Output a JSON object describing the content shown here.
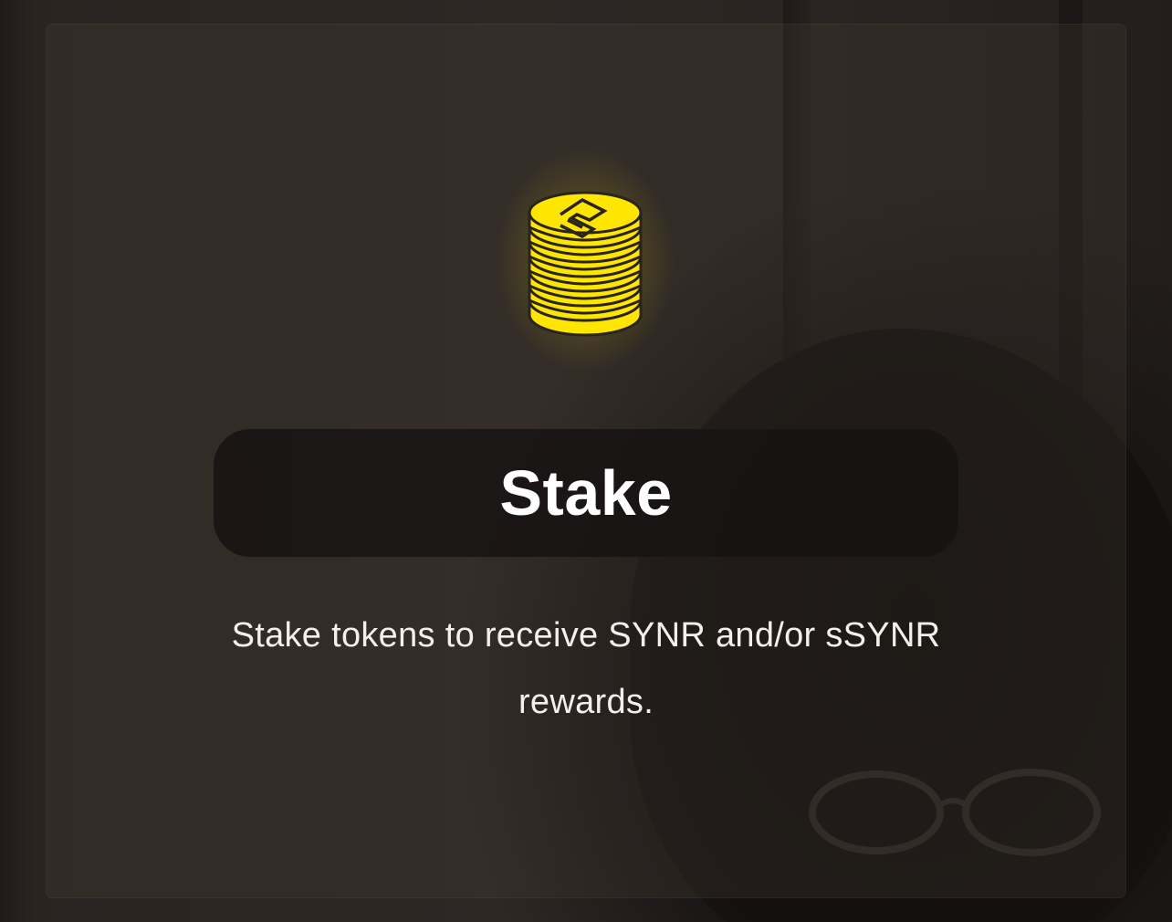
{
  "card": {
    "title": "Stake",
    "description": "Stake tokens to receive SYNR and/or sSYNR rewards.",
    "icon": "coin-stack-icon"
  },
  "colors": {
    "accent": "#FFE600",
    "title_text": "#FFFFFF",
    "pill_background": "#161212"
  }
}
